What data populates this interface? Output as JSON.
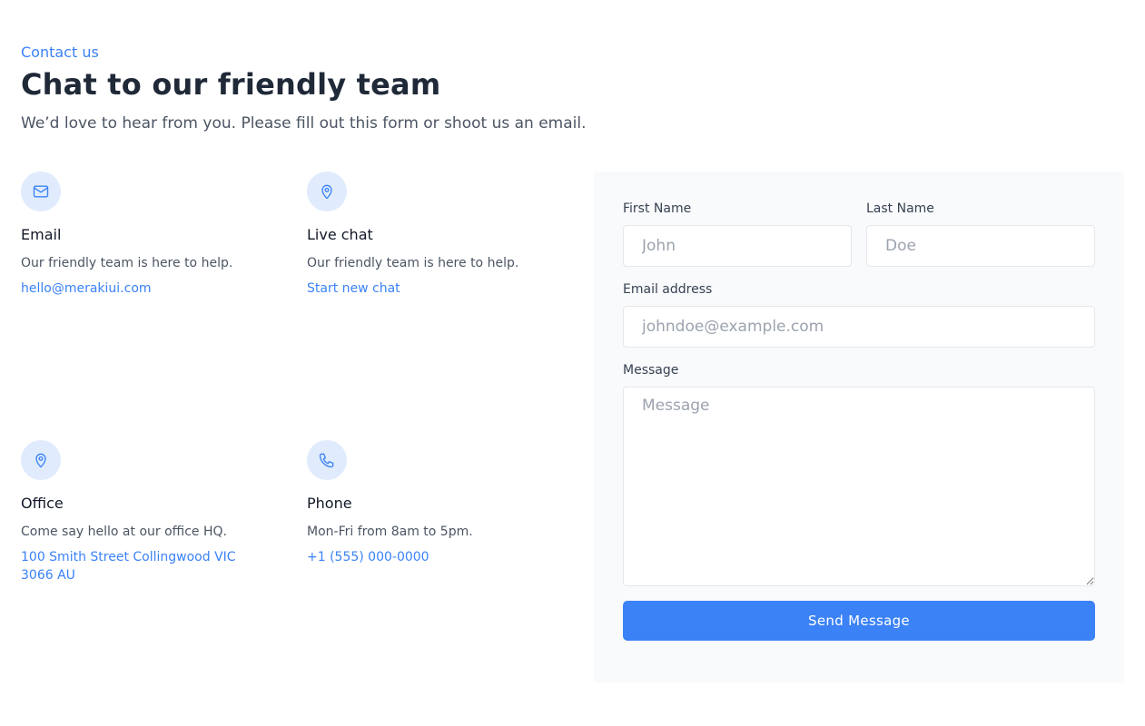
{
  "header": {
    "eyebrow": "Contact us",
    "title": "Chat to our friendly team",
    "subtitle": "We’d love to hear from you. Please fill out this form or shoot us an email."
  },
  "contacts": [
    {
      "icon": "mail-icon",
      "title": "Email",
      "description": "Our friendly team is here to help.",
      "link": "hello@merakiui.com"
    },
    {
      "icon": "map-pin-icon",
      "title": "Live chat",
      "description": "Our friendly team is here to help.",
      "link": "Start new chat"
    },
    {
      "icon": "map-pin-icon",
      "title": "Office",
      "description": "Come say hello at our office HQ.",
      "link": "100 Smith Street Collingwood VIC 3066 AU"
    },
    {
      "icon": "phone-icon",
      "title": "Phone",
      "description": "Mon-Fri from 8am to 5pm.",
      "link": "+1 (555) 000-0000"
    }
  ],
  "form": {
    "first_name": {
      "label": "First Name",
      "placeholder": "John",
      "value": ""
    },
    "last_name": {
      "label": "Last Name",
      "placeholder": "Doe",
      "value": ""
    },
    "email": {
      "label": "Email address",
      "placeholder": "johndoe@example.com",
      "value": ""
    },
    "message": {
      "label": "Message",
      "placeholder": "Message",
      "value": ""
    },
    "submit_label": "Send Message"
  },
  "colors": {
    "accent": "#3b82f6",
    "icon_bg": "#e0ecfd",
    "panel_bg": "#f8fafc"
  }
}
